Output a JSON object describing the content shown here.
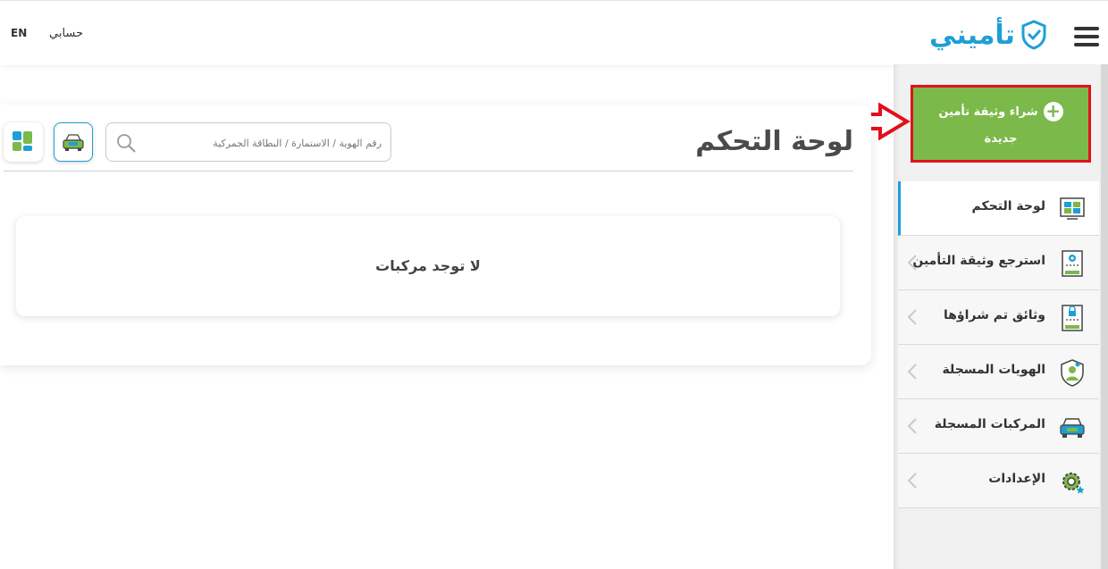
{
  "header": {
    "lang_label": "EN",
    "account_label": "حسابي",
    "logo_text": "تأميني"
  },
  "sidebar": {
    "buy_button": {
      "line1": "شراء وثيقة تأمين",
      "line2": "جديدة"
    },
    "items": [
      {
        "label": "لوحة التحكم",
        "icon": "dashboard-icon",
        "active": true
      },
      {
        "label": "استرجع وثيقة التأمين",
        "icon": "retrieve-document-icon"
      },
      {
        "label": "وثائق تم شراؤها",
        "icon": "purchased-documents-icon"
      },
      {
        "label": "الهويات المسجلة",
        "icon": "identity-shield-icon"
      },
      {
        "label": "المركبات المسجلة",
        "icon": "car-icon"
      },
      {
        "label": "الإعدادات",
        "icon": "gear-icon"
      }
    ]
  },
  "main": {
    "title": "لوحة التحكم",
    "search": {
      "placeholder": "رقم الهوية / الاستمارة / البطاقة الجمركية",
      "value": ""
    },
    "empty_message": "لا توجد مركبات"
  },
  "colors": {
    "brand_blue": "#1e9fd6",
    "brand_green": "#7bb94a",
    "highlight_red": "#e3101c"
  }
}
